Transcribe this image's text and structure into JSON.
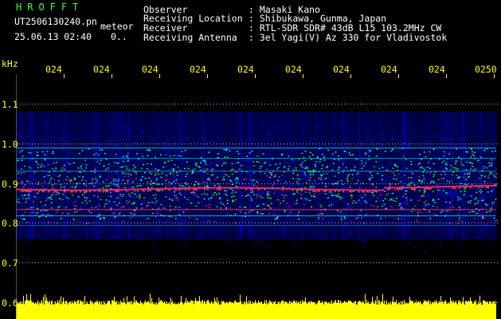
{
  "header": {
    "logo": "HROFFT",
    "filename": "UT2506130240.pn",
    "mode": "meteor",
    "datetime": "25.06.13 02:40",
    "extra": "0..",
    "fields": [
      {
        "label": "Observer",
        "value": ": Masaki Kano"
      },
      {
        "label": "Receiving Location",
        "value": ": Shibukawa, Gunma, Japan"
      },
      {
        "label": "Receiver",
        "value": ": RTL-SDR SDR# 43dB L15 103.2MHz CW"
      },
      {
        "label": "Receiving Antenna",
        "value": ": 3el Yagi(V) Az 330 for Vladivostok"
      }
    ]
  },
  "axes": {
    "y_unit": "kHz",
    "y_ticks": [
      "1.1",
      "1.0",
      "0.9",
      "0.8",
      "0.7",
      "0.6"
    ],
    "x_ticks": [
      "024",
      "024",
      "024",
      "024",
      "024",
      "024",
      "024",
      "024",
      "024",
      "0250"
    ]
  },
  "colors": {
    "noise_floor": "#000080",
    "signal_low": "#0000ff",
    "signal_mid": "#00ffff",
    "signal_high": "#00ff00",
    "peak": "#ff3060",
    "audio_level": "#ffff00",
    "tick_text": "#ffff00"
  }
}
